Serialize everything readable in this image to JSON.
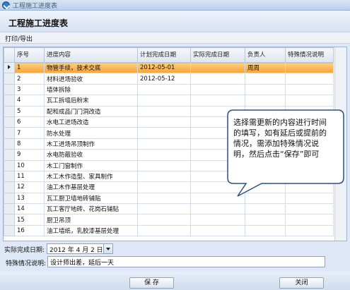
{
  "window": {
    "title": "工程施工进度表",
    "icon": "app-icon"
  },
  "header": {
    "heading": "工程施工进度表"
  },
  "menu": {
    "print_export": "打印/导出"
  },
  "table": {
    "columns": [
      "序号",
      "进度内容",
      "计划完成日期",
      "实际完成日期",
      "负责人",
      "特殊情况说明"
    ],
    "rows": [
      [
        "1",
        "物管手续，技术交底",
        "2012-05-01",
        "",
        "周周",
        ""
      ],
      [
        "2",
        "材料进场验收",
        "2012-05-12",
        "",
        "",
        ""
      ],
      [
        "3",
        "墙体拆除",
        "",
        "",
        "",
        ""
      ],
      [
        "4",
        "瓦工拆墙后粉末",
        "",
        "",
        "",
        ""
      ],
      [
        "5",
        "配和成品门门洞改造",
        "",
        "",
        "",
        ""
      ],
      [
        "6",
        "水电工进场改造",
        "",
        "",
        "",
        ""
      ],
      [
        "7",
        "防水处理",
        "",
        "",
        "",
        ""
      ],
      [
        "8",
        "木工进场吊顶制作",
        "",
        "",
        "",
        ""
      ],
      [
        "9",
        "水电防蔽验收",
        "",
        "",
        "",
        ""
      ],
      [
        "10",
        "木工门窗制作",
        "",
        "",
        "",
        ""
      ],
      [
        "11",
        "木工木作造型、家具制作",
        "",
        "",
        "",
        ""
      ],
      [
        "12",
        "油工木作基层处理",
        "",
        "",
        "",
        ""
      ],
      [
        "13",
        "瓦工厨卫墙地砖铺贴",
        "",
        "",
        "",
        ""
      ],
      [
        "14",
        "瓦工客厅地砖、花岗石铺贴",
        "",
        "",
        "",
        ""
      ],
      [
        "15",
        "厨卫吊顶",
        "",
        "",
        "",
        ""
      ],
      [
        "16",
        "油工墙纸，乳胶漆基层处理",
        "",
        "",
        "",
        ""
      ]
    ],
    "selected_row": 1
  },
  "actual_date": {
    "label": "实际完成日期:",
    "value": "2012 年 4 月 2 日"
  },
  "special_note": {
    "label": "特殊情况说明:",
    "value": "设计师出差，延后一天"
  },
  "buttons": {
    "save": "保 存",
    "close": "关闭"
  },
  "callout": {
    "text": "选择需更新的内容进行时间的填写，如有延后或提前的情况，需添加特殊情况说明，然后点击“保存”即可"
  }
}
